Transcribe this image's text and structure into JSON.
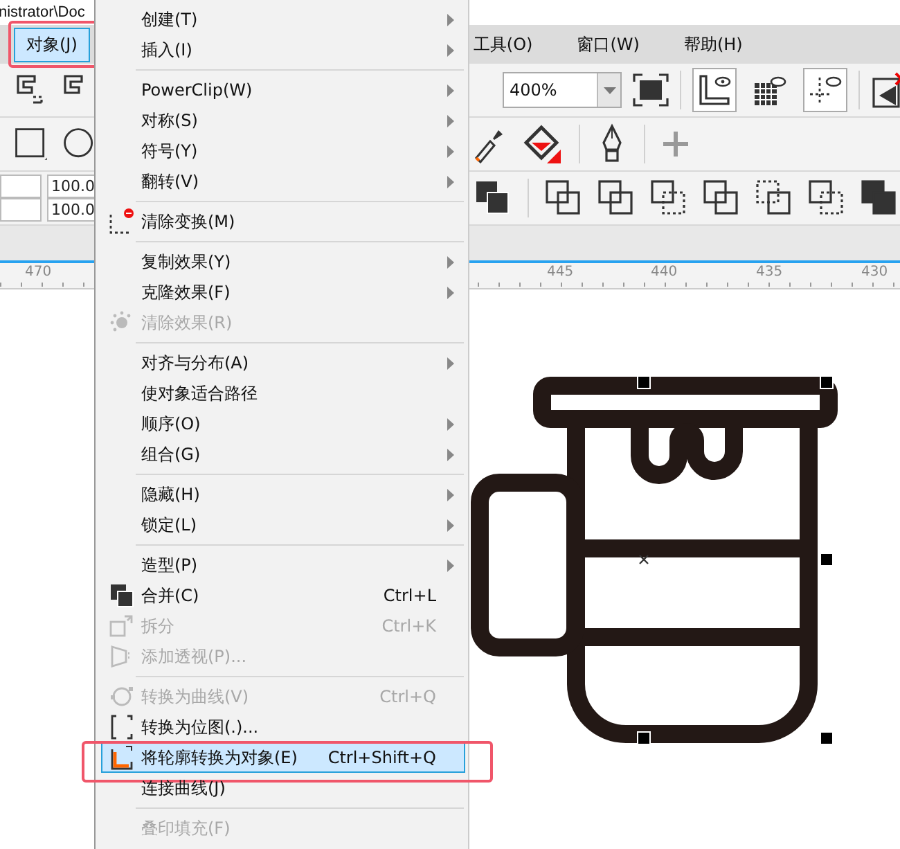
{
  "title_fragment": "nistrator\\Doc",
  "menubar": [
    {
      "label": "对象(J)",
      "selected": true
    },
    {
      "label": "工具(O)",
      "selected": false
    },
    {
      "label": "窗口(W)",
      "selected": false
    },
    {
      "label": "帮助(H)",
      "selected": false
    }
  ],
  "zoom_combo": {
    "value": "400%"
  },
  "view_buttons": [
    {
      "pressed": true
    },
    {
      "pressed": false
    },
    {
      "pressed": true
    }
  ],
  "size_fields": [
    "100.0",
    "100.0"
  ],
  "ruler_labels": [
    "470",
    "445",
    "440",
    "435",
    "430"
  ],
  "menu": [
    {
      "kind": "item",
      "label": "创建(T)",
      "submenu": true,
      "disabled": false,
      "selected": false
    },
    {
      "kind": "item",
      "label": "插入(I)",
      "submenu": true,
      "disabled": false,
      "selected": false
    },
    {
      "kind": "separator"
    },
    {
      "kind": "item",
      "label": "PowerClip(W)",
      "submenu": true,
      "disabled": false,
      "selected": false
    },
    {
      "kind": "item",
      "label": "对称(S)",
      "submenu": true,
      "disabled": false,
      "selected": false
    },
    {
      "kind": "item",
      "label": "符号(Y)",
      "submenu": true,
      "disabled": false,
      "selected": false
    },
    {
      "kind": "item",
      "label": "翻转(V)",
      "submenu": true,
      "disabled": false,
      "selected": false
    },
    {
      "kind": "separator"
    },
    {
      "kind": "item",
      "label": "清除变换(M)",
      "submenu": false,
      "disabled": false,
      "selected": false
    },
    {
      "kind": "separator"
    },
    {
      "kind": "item",
      "label": "复制效果(Y)",
      "submenu": true,
      "disabled": false,
      "selected": false
    },
    {
      "kind": "item",
      "label": "克隆效果(F)",
      "submenu": true,
      "disabled": false,
      "selected": false
    },
    {
      "kind": "item",
      "label": "清除效果(R)",
      "submenu": false,
      "disabled": true,
      "selected": false
    },
    {
      "kind": "separator"
    },
    {
      "kind": "item",
      "label": "对齐与分布(A)",
      "submenu": true,
      "disabled": false,
      "selected": false
    },
    {
      "kind": "item",
      "label": "使对象适合路径",
      "submenu": false,
      "disabled": false,
      "selected": false
    },
    {
      "kind": "item",
      "label": "顺序(O)",
      "submenu": true,
      "disabled": false,
      "selected": false
    },
    {
      "kind": "item",
      "label": "组合(G)",
      "submenu": true,
      "disabled": false,
      "selected": false
    },
    {
      "kind": "separator"
    },
    {
      "kind": "item",
      "label": "隐藏(H)",
      "submenu": true,
      "disabled": false,
      "selected": false
    },
    {
      "kind": "item",
      "label": "锁定(L)",
      "submenu": true,
      "disabled": false,
      "selected": false
    },
    {
      "kind": "separator"
    },
    {
      "kind": "item",
      "label": "造型(P)",
      "submenu": true,
      "disabled": false,
      "selected": false
    },
    {
      "kind": "item",
      "label": "合并(C)",
      "shortcut": "Ctrl+L",
      "submenu": false,
      "disabled": false,
      "selected": false
    },
    {
      "kind": "item",
      "label": "拆分",
      "shortcut": "Ctrl+K",
      "submenu": false,
      "disabled": true,
      "selected": false
    },
    {
      "kind": "item",
      "label": "添加透视(P)...",
      "submenu": false,
      "disabled": true,
      "selected": false
    },
    {
      "kind": "separator"
    },
    {
      "kind": "item",
      "label": "转换为曲线(V)",
      "shortcut": "Ctrl+Q",
      "submenu": false,
      "disabled": true,
      "selected": false
    },
    {
      "kind": "item",
      "label": "转换为位图(.)...",
      "submenu": false,
      "disabled": false,
      "selected": false
    },
    {
      "kind": "item",
      "label": "将轮廓转换为对象(E)",
      "shortcut": "Ctrl+Shift+Q",
      "submenu": false,
      "disabled": false,
      "selected": true
    },
    {
      "kind": "item",
      "label": "连接曲线(J)",
      "submenu": false,
      "disabled": false,
      "selected": false
    },
    {
      "kind": "separator"
    },
    {
      "kind": "item",
      "label": "叠印填充(F)",
      "submenu": false,
      "disabled": true,
      "selected": false
    }
  ]
}
